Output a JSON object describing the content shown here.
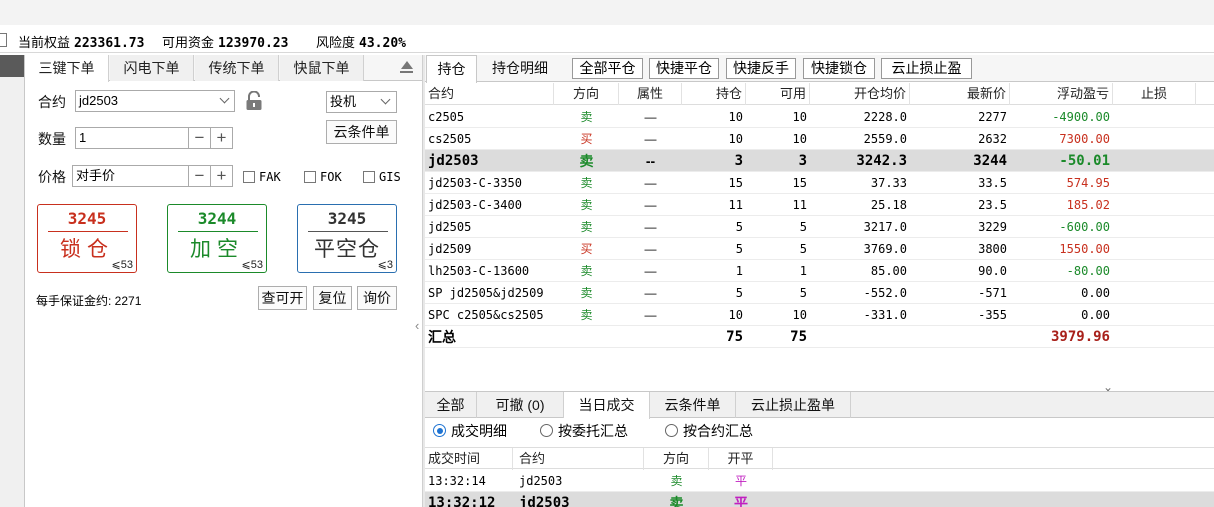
{
  "status": {
    "equity_label": "当前权益",
    "equity_value": "223361.73",
    "available_label": "可用资金",
    "available_value": "123970.23",
    "risk_label": "风险度",
    "risk_value": "43.20%"
  },
  "order_panel": {
    "tabs": [
      "三键下单",
      "闪电下单",
      "传统下单",
      "快鼠下单"
    ],
    "contract_label": "合约",
    "contract_value": "jd2503",
    "type_value": "投机",
    "qty_label": "数量",
    "qty_value": "1",
    "cloud_order_label": "云条件单",
    "price_label": "价格",
    "price_value": "对手价",
    "checks": [
      "FAK",
      "FOK",
      "GIS"
    ],
    "buttons": [
      {
        "price": "3245",
        "action": "锁仓",
        "qty": "⩽53",
        "color": "#c8301e"
      },
      {
        "price": "3244",
        "action": "加空",
        "qty": "⩽53",
        "color": "#1b8a2a"
      },
      {
        "price": "3245",
        "action": "平空仓",
        "qty": "⩽3",
        "color": "#333333"
      }
    ],
    "margin_text": "每手保证金约: 2271",
    "query_open_label": "查可开",
    "reset_label": "复位",
    "ask_label": "询价"
  },
  "positions": {
    "tab_hold": "持仓",
    "tab_detail": "持仓明细",
    "toolbar": [
      "全部平仓",
      "快捷平仓",
      "快捷反手",
      "快捷锁仓",
      "云止损止盈"
    ],
    "headers": [
      "合约",
      "方向",
      "属性",
      "持仓",
      "可用",
      "开仓均价",
      "最新价",
      "浮动盈亏",
      "止损"
    ],
    "rows": [
      {
        "contract": "c2505",
        "dir": "卖",
        "attr": "—",
        "hold": "10",
        "avail": "10",
        "avg": "2228.0",
        "last": "2277",
        "pnl": "-4900.00",
        "pnl_color": "green",
        "dir_color": "green"
      },
      {
        "contract": "cs2505",
        "dir": "买",
        "attr": "—",
        "hold": "10",
        "avail": "10",
        "avg": "2559.0",
        "last": "2632",
        "pnl": "7300.00",
        "pnl_color": "red",
        "dir_color": "red"
      },
      {
        "contract": "jd2503",
        "dir": "卖",
        "attr": "--",
        "hold": "3",
        "avail": "3",
        "avg": "3242.3",
        "last": "3244",
        "pnl": "-50.01",
        "pnl_color": "green",
        "dir_color": "green",
        "selected": true
      },
      {
        "contract": "jd2503-C-3350",
        "dir": "卖",
        "attr": "—",
        "hold": "15",
        "avail": "15",
        "avg": "37.33",
        "last": "33.5",
        "pnl": "574.95",
        "pnl_color": "red",
        "dir_color": "green"
      },
      {
        "contract": "jd2503-C-3400",
        "dir": "卖",
        "attr": "—",
        "hold": "11",
        "avail": "11",
        "avg": "25.18",
        "last": "23.5",
        "pnl": "185.02",
        "pnl_color": "red",
        "dir_color": "green"
      },
      {
        "contract": "jd2505",
        "dir": "卖",
        "attr": "—",
        "hold": "5",
        "avail": "5",
        "avg": "3217.0",
        "last": "3229",
        "pnl": "-600.00",
        "pnl_color": "green",
        "dir_color": "green"
      },
      {
        "contract": "jd2509",
        "dir": "买",
        "attr": "—",
        "hold": "5",
        "avail": "5",
        "avg": "3769.0",
        "last": "3800",
        "pnl": "1550.00",
        "pnl_color": "red",
        "dir_color": "red"
      },
      {
        "contract": "lh2503-C-13600",
        "dir": "卖",
        "attr": "—",
        "hold": "1",
        "avail": "1",
        "avg": "85.00",
        "last": "90.0",
        "pnl": "-80.00",
        "pnl_color": "green",
        "dir_color": "green"
      },
      {
        "contract": "SP jd2505&jd2509",
        "dir": "卖",
        "attr": "—",
        "hold": "5",
        "avail": "5",
        "avg": "-552.0",
        "last": "-571",
        "pnl": "0.00",
        "pnl_color": "black",
        "dir_color": "green"
      },
      {
        "contract": "SPC c2505&cs2505",
        "dir": "卖",
        "attr": "—",
        "hold": "10",
        "avail": "10",
        "avg": "-331.0",
        "last": "-355",
        "pnl": "0.00",
        "pnl_color": "black",
        "dir_color": "green"
      }
    ],
    "total": {
      "label": "汇总",
      "hold": "75",
      "avail": "75",
      "pnl": "3979.96"
    }
  },
  "trades": {
    "tabs": [
      "全部",
      "可撤  (0)",
      "当日成交",
      "云条件单",
      "云止损止盈单"
    ],
    "radios": [
      "成交明细",
      "按委托汇总",
      "按合约汇总"
    ],
    "headers": [
      "成交时间",
      "合约",
      "方向",
      "开平"
    ],
    "rows": [
      {
        "time": "13:32:14",
        "contract": "jd2503",
        "dir": "卖",
        "oc": "平"
      },
      {
        "time": "13:32:12",
        "contract": "jd2503",
        "dir": "卖",
        "oc": "平"
      }
    ]
  }
}
